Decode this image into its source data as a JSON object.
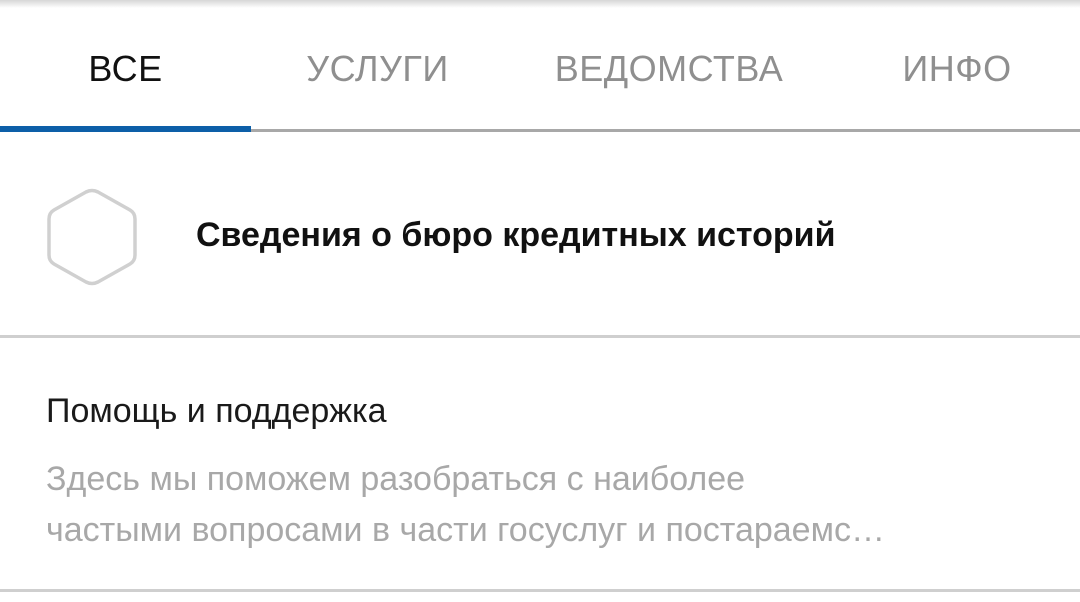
{
  "tabs": [
    {
      "label": "ВСЕ",
      "active": true
    },
    {
      "label": "УСЛУГИ",
      "active": false
    },
    {
      "label": "ВЕДОМСТВА",
      "active": false
    },
    {
      "label": "ИНФО",
      "active": false
    }
  ],
  "colors": {
    "accent": "#0d5fa8",
    "tab_inactive": "#8f8f8f",
    "text_primary": "#111111",
    "text_secondary": "#a8a8a8",
    "divider": "#cfcfcf",
    "icon_outline": "#d0d0d0"
  },
  "results": {
    "service": {
      "icon": "hexagon-icon",
      "title": "Сведения о бюро кредитных историй"
    },
    "help": {
      "title": "Помощь и поддержка",
      "description_line1": "Здесь мы поможем разобраться с наиболее",
      "description_line2": "частыми вопросами в части госуслуг и постараемс…"
    }
  }
}
